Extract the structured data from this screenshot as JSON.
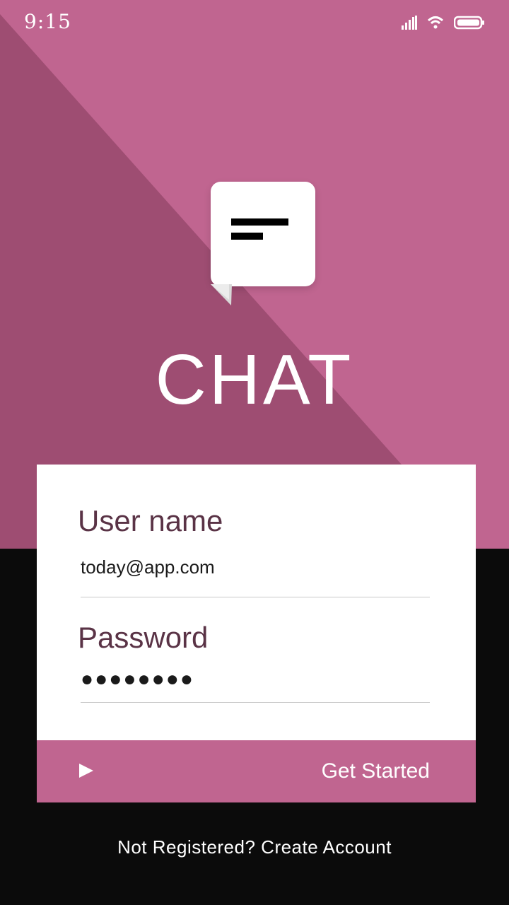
{
  "status_bar": {
    "time": "9:15",
    "signal_icon": "signal-icon",
    "wifi_icon": "wifi-icon",
    "battery_icon": "battery-icon"
  },
  "app": {
    "title": "CHAT",
    "logo_icon": "chat-bubble-icon"
  },
  "colors": {
    "accent": "#c06590",
    "accent_dark": "#9e4d72",
    "label": "#5a3346",
    "background": "#0b0b0b"
  },
  "form": {
    "username": {
      "label": "User name",
      "value": "today@app.com"
    },
    "password": {
      "label": "Password",
      "value": "●●●●●●●●"
    }
  },
  "cta": {
    "label": "Get Started",
    "icon": "play-arrow-icon"
  },
  "footer": {
    "register_text": "Not Registered? Create Account"
  }
}
